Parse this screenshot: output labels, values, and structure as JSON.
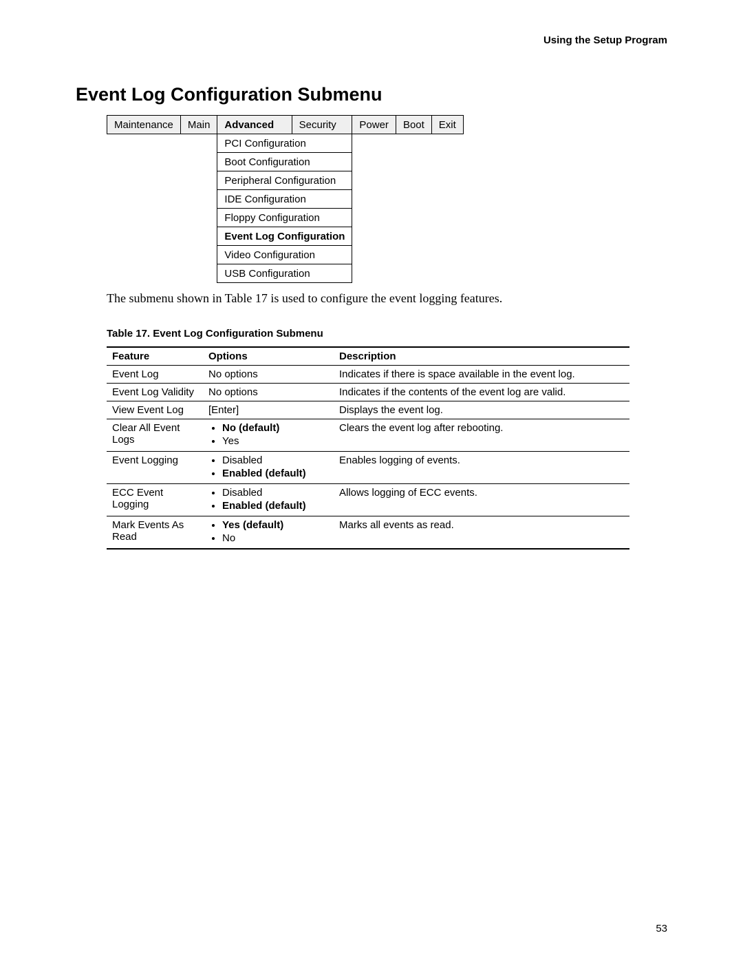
{
  "running_header": "Using the Setup Program",
  "section_title": "Event Log Configuration Submenu",
  "menu": {
    "tabs": [
      {
        "label": "Maintenance",
        "active": false
      },
      {
        "label": "Main",
        "active": false
      },
      {
        "label": "Advanced",
        "active": true
      },
      {
        "label": "Security",
        "active": false
      },
      {
        "label": "Power",
        "active": false
      },
      {
        "label": "Boot",
        "active": false
      },
      {
        "label": "Exit",
        "active": false
      }
    ],
    "submenu": [
      {
        "label": "PCI Configuration",
        "bold": false
      },
      {
        "label": "Boot Configuration",
        "bold": false
      },
      {
        "label": "Peripheral Configuration",
        "bold": false
      },
      {
        "label": "IDE Configuration",
        "bold": false
      },
      {
        "label": "Floppy Configuration",
        "bold": false
      },
      {
        "label": "Event Log Configuration",
        "bold": true
      },
      {
        "label": "Video Configuration",
        "bold": false
      },
      {
        "label": "USB Configuration",
        "bold": false
      }
    ]
  },
  "intro_text": "The submenu shown in Table 17 is used to configure the event logging features.",
  "table_caption": "Table 17.    Event Log Configuration Submenu",
  "feature_table": {
    "headers": {
      "feature": "Feature",
      "options": "Options",
      "description": "Description"
    },
    "rows": [
      {
        "feature": "Event Log",
        "options_text": "No options",
        "options_list": null,
        "description": "Indicates if there is space available in the event log."
      },
      {
        "feature": "Event Log Validity",
        "options_text": "No options",
        "options_list": null,
        "description": "Indicates if the contents of the event log are valid."
      },
      {
        "feature": "View Event Log",
        "options_text": "[Enter]",
        "options_list": null,
        "description": "Displays the event log."
      },
      {
        "feature": "Clear All Event Logs",
        "options_text": null,
        "options_list": [
          {
            "label": "No (default)",
            "bold": true
          },
          {
            "label": "Yes",
            "bold": false
          }
        ],
        "description": "Clears the event log after rebooting."
      },
      {
        "feature": "Event Logging",
        "options_text": null,
        "options_list": [
          {
            "label": "Disabled",
            "bold": false
          },
          {
            "label": "Enabled (default)",
            "bold": true
          }
        ],
        "description": "Enables logging of events."
      },
      {
        "feature": "ECC Event Logging",
        "options_text": null,
        "options_list": [
          {
            "label": "Disabled",
            "bold": false
          },
          {
            "label": "Enabled (default)",
            "bold": true
          }
        ],
        "description": "Allows logging of ECC events."
      },
      {
        "feature": "Mark Events As Read",
        "options_text": null,
        "options_list": [
          {
            "label": "Yes (default)",
            "bold": true
          },
          {
            "label": "No",
            "bold": false
          }
        ],
        "description": "Marks all events as read."
      }
    ]
  },
  "page_number": "53"
}
